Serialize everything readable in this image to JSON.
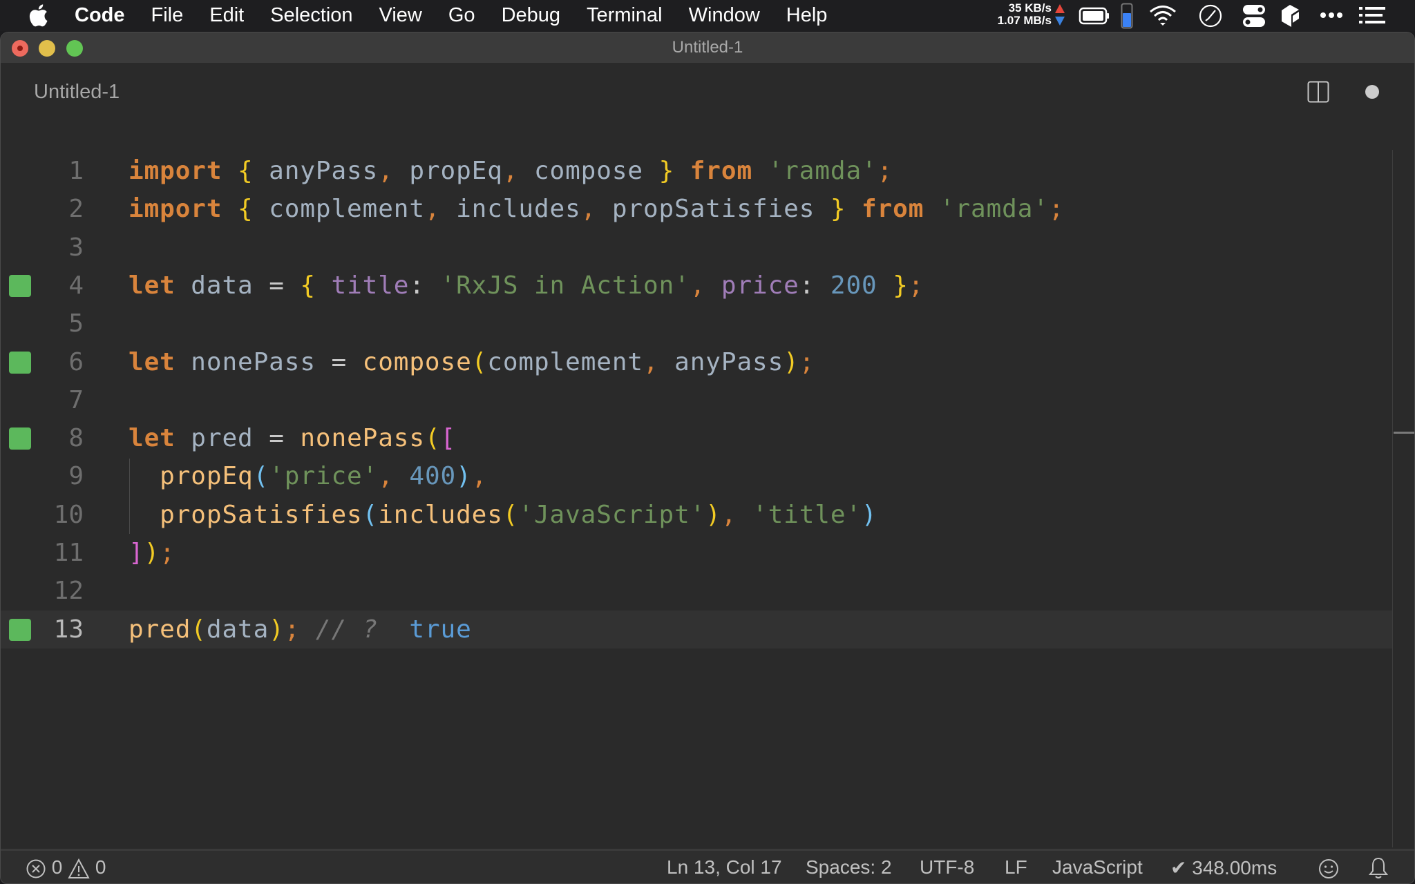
{
  "menubar": {
    "apple_icon": "apple-logo-icon",
    "items": [
      "Code",
      "File",
      "Edit",
      "Selection",
      "View",
      "Go",
      "Debug",
      "Terminal",
      "Window",
      "Help"
    ],
    "net_upload": "35 KB/s",
    "net_download": "1.07 MB/s",
    "tray_icons": [
      "battery-icon",
      "memory-gauge-icon",
      "wifi-icon",
      "clock-icon",
      "toggles-icon",
      "package-icon",
      "more-icon",
      "list-icon"
    ]
  },
  "window": {
    "title": "Untitled-1",
    "tab_label": "Untitled-1",
    "split_icon": "split-editor-icon",
    "dirty_indicator": "unsaved-dot-icon"
  },
  "editor": {
    "current_line": 13,
    "lines": [
      {
        "n": "1",
        "marker": false,
        "tokens": [
          [
            "kw",
            "import"
          ],
          [
            "op",
            " "
          ],
          [
            "brace",
            "{"
          ],
          [
            "id",
            " anyPass"
          ],
          [
            "punct",
            ","
          ],
          [
            "id",
            " propEq"
          ],
          [
            "punct",
            ","
          ],
          [
            "id",
            " compose "
          ],
          [
            "brace",
            "}"
          ],
          [
            "op",
            " "
          ],
          [
            "kw",
            "from"
          ],
          [
            "op",
            " "
          ],
          [
            "str",
            "'ramda'"
          ],
          [
            "punct",
            ";"
          ]
        ]
      },
      {
        "n": "2",
        "marker": false,
        "tokens": [
          [
            "kw",
            "import"
          ],
          [
            "op",
            " "
          ],
          [
            "brace",
            "{"
          ],
          [
            "id",
            " complement"
          ],
          [
            "punct",
            ","
          ],
          [
            "id",
            " includes"
          ],
          [
            "punct",
            ","
          ],
          [
            "id",
            " propSatisfies "
          ],
          [
            "brace",
            "}"
          ],
          [
            "op",
            " "
          ],
          [
            "kw",
            "from"
          ],
          [
            "op",
            " "
          ],
          [
            "str",
            "'ramda'"
          ],
          [
            "punct",
            ";"
          ]
        ]
      },
      {
        "n": "3",
        "marker": false,
        "tokens": []
      },
      {
        "n": "4",
        "marker": true,
        "tokens": [
          [
            "kw",
            "let"
          ],
          [
            "id",
            " data "
          ],
          [
            "op",
            "="
          ],
          [
            "op",
            " "
          ],
          [
            "brace",
            "{"
          ],
          [
            "op",
            " "
          ],
          [
            "prop",
            "title"
          ],
          [
            "op",
            ": "
          ],
          [
            "str",
            "'RxJS in Action'"
          ],
          [
            "punct",
            ","
          ],
          [
            "op",
            " "
          ],
          [
            "prop",
            "price"
          ],
          [
            "op",
            ": "
          ],
          [
            "num",
            "200"
          ],
          [
            "op",
            " "
          ],
          [
            "brace",
            "}"
          ],
          [
            "punct",
            ";"
          ]
        ]
      },
      {
        "n": "5",
        "marker": false,
        "tokens": []
      },
      {
        "n": "6",
        "marker": true,
        "tokens": [
          [
            "kw",
            "let"
          ],
          [
            "id",
            " nonePass "
          ],
          [
            "op",
            "="
          ],
          [
            "op",
            " "
          ],
          [
            "fn",
            "compose"
          ],
          [
            "brace",
            "("
          ],
          [
            "id",
            "complement"
          ],
          [
            "punct",
            ","
          ],
          [
            "id",
            " anyPass"
          ],
          [
            "brace",
            ")"
          ],
          [
            "punct",
            ";"
          ]
        ]
      },
      {
        "n": "7",
        "marker": false,
        "tokens": []
      },
      {
        "n": "8",
        "marker": true,
        "tokens": [
          [
            "kw",
            "let"
          ],
          [
            "id",
            " pred "
          ],
          [
            "op",
            "="
          ],
          [
            "op",
            " "
          ],
          [
            "fn",
            "nonePass"
          ],
          [
            "brace",
            "("
          ],
          [
            "bracket",
            "["
          ]
        ]
      },
      {
        "n": "9",
        "marker": false,
        "tokens": [
          [
            "op",
            "  "
          ],
          [
            "fn",
            "propEq"
          ],
          [
            "paren2",
            "("
          ],
          [
            "str",
            "'price'"
          ],
          [
            "punct",
            ","
          ],
          [
            "op",
            " "
          ],
          [
            "num",
            "400"
          ],
          [
            "paren2",
            ")"
          ],
          [
            "punct",
            ","
          ]
        ]
      },
      {
        "n": "10",
        "marker": false,
        "tokens": [
          [
            "op",
            "  "
          ],
          [
            "fn",
            "propSatisfies"
          ],
          [
            "paren2",
            "("
          ],
          [
            "fn",
            "includes"
          ],
          [
            "brace",
            "("
          ],
          [
            "str",
            "'JavaScript'"
          ],
          [
            "brace",
            ")"
          ],
          [
            "punct",
            ","
          ],
          [
            "op",
            " "
          ],
          [
            "str",
            "'title'"
          ],
          [
            "paren2",
            ")"
          ]
        ]
      },
      {
        "n": "11",
        "marker": false,
        "tokens": [
          [
            "bracket",
            "]"
          ],
          [
            "brace",
            ")"
          ],
          [
            "punct",
            ";"
          ]
        ]
      },
      {
        "n": "12",
        "marker": false,
        "tokens": []
      },
      {
        "n": "13",
        "marker": true,
        "tokens": [
          [
            "fn",
            "pred"
          ],
          [
            "brace",
            "("
          ],
          [
            "id",
            "data"
          ],
          [
            "brace",
            ")"
          ],
          [
            "punct",
            ";"
          ],
          [
            "op",
            " "
          ],
          [
            "comment",
            "// ?"
          ],
          [
            "op",
            "  "
          ],
          [
            "result",
            "true"
          ]
        ]
      }
    ]
  },
  "statusbar": {
    "errors": "0",
    "warnings": "0",
    "cursor": "Ln 13, Col 17",
    "indent": "Spaces: 2",
    "encoding": "UTF-8",
    "eol": "LF",
    "language": "JavaScript",
    "timing": "✔ 348.00ms",
    "feedback_icon": "smiley-icon",
    "notifications_icon": "bell-icon"
  },
  "colors": {
    "gutter_marker": "#5cb85c",
    "keyword": "#d9843c",
    "string": "#6f925b",
    "number": "#6897bb",
    "function": "#f5c07a"
  }
}
